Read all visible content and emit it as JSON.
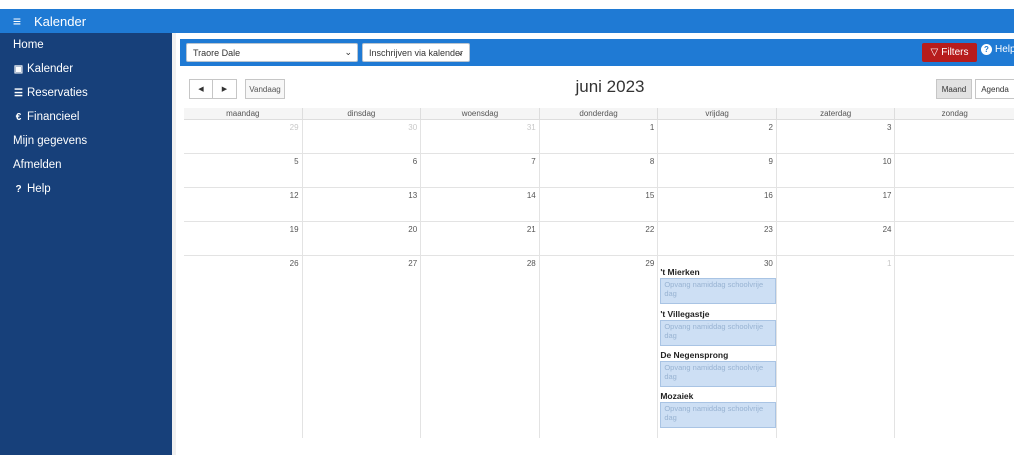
{
  "app": {
    "title": "Kalender",
    "menu_icon": "hamburger-icon"
  },
  "sidebar": {
    "items": [
      {
        "label": "Home",
        "icon": ""
      },
      {
        "label": "Kalender",
        "icon": "calendar-icon"
      },
      {
        "label": "Reservaties",
        "icon": "list-icon"
      },
      {
        "label": "Financieel",
        "icon": "euro-icon"
      },
      {
        "label": "Mijn gegevens",
        "icon": ""
      },
      {
        "label": "Afmelden",
        "icon": ""
      },
      {
        "label": "Help",
        "icon": "question-icon"
      }
    ]
  },
  "toolbar": {
    "child_select": "Traore Dale",
    "register_select": "Inschrijven via kalender",
    "filters_label": "Filters",
    "help_label": "Help"
  },
  "calendar": {
    "today_label": "Vandaag",
    "title": "juni 2023",
    "view_month": "Maand",
    "view_agenda": "Agenda",
    "weekdays": [
      "maandag",
      "dinsdag",
      "woensdag",
      "donderdag",
      "vrijdag",
      "zaterdag",
      "zondag"
    ],
    "weeks": [
      [
        "29",
        "30",
        "31",
        "1",
        "2",
        "3",
        ""
      ],
      [
        "5",
        "6",
        "7",
        "8",
        "9",
        "10",
        ""
      ],
      [
        "12",
        "13",
        "14",
        "15",
        "16",
        "17",
        ""
      ],
      [
        "19",
        "20",
        "21",
        "22",
        "23",
        "24",
        ""
      ],
      [
        "26",
        "27",
        "28",
        "29",
        "30",
        "1",
        ""
      ]
    ],
    "events": [
      {
        "location": "'t Mierken",
        "label": "Opvang namiddag schoolvrije dag"
      },
      {
        "location": "'t Villegastje",
        "label": "Opvang namiddag schoolvrije dag"
      },
      {
        "location": "De Negensprong",
        "label": "Opvang namiddag schoolvrije dag"
      },
      {
        "location": "Mozaiek",
        "label": "Opvang namiddag schoolvrije dag"
      }
    ]
  },
  "colors": {
    "topbar": "#1f7ad4",
    "sidebar": "#17407a",
    "filters": "#b71c1c",
    "event": "#cddff4"
  }
}
